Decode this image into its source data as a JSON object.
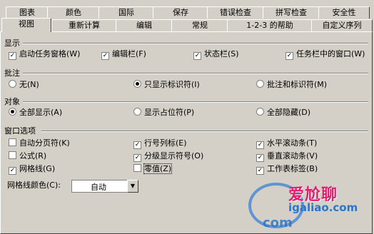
{
  "tabs_back": [
    "图表",
    "颜色",
    "国际",
    "保存",
    "错误检查",
    "拼写检查",
    "安全性"
  ],
  "tabs_front": [
    "视图",
    "重新计算",
    "编辑",
    "常规",
    "1-2-3 的帮助",
    "自定义序列"
  ],
  "active_tab": "视图",
  "sections": {
    "display": {
      "label": "显示",
      "options": [
        {
          "label": "启动任务窗格(W)",
          "checked": true
        },
        {
          "label": "编辑栏(F)",
          "checked": true
        },
        {
          "label": "状态栏(S)",
          "checked": true
        },
        {
          "label": "任务栏中的窗口(W)",
          "checked": true
        }
      ]
    },
    "comments": {
      "label": "批注",
      "options": [
        {
          "label": "无(N)",
          "selected": false
        },
        {
          "label": "只显示标识符(I)",
          "selected": true
        },
        {
          "label": "批注和标识符(M)",
          "selected": false
        }
      ]
    },
    "objects": {
      "label": "对象",
      "options": [
        {
          "label": "全部显示(A)",
          "selected": true
        },
        {
          "label": "显示占位符(P)",
          "selected": false
        },
        {
          "label": "全部隐藏(D)",
          "selected": false
        }
      ]
    },
    "window": {
      "label": "窗口选项",
      "options": [
        {
          "label": "自动分页符(K)",
          "checked": false
        },
        {
          "label": "行号列标(E)",
          "checked": true
        },
        {
          "label": "水平滚动条(T)",
          "checked": true
        },
        {
          "label": "公式(R)",
          "checked": false
        },
        {
          "label": "分级显示符号(O)",
          "checked": true
        },
        {
          "label": "垂直滚动条(V)",
          "checked": true
        },
        {
          "label": "网格线(G)",
          "checked": true
        },
        {
          "label": "零值(Z)",
          "checked": false
        },
        {
          "label": "工作表标签(B)",
          "checked": true
        }
      ]
    }
  },
  "gridline_color": {
    "label": "网格线颜色(C):",
    "value": "自动"
  },
  "watermark": {
    "cn": "爱尬聊",
    "url": "igaliao.com",
    "url2": "com"
  }
}
